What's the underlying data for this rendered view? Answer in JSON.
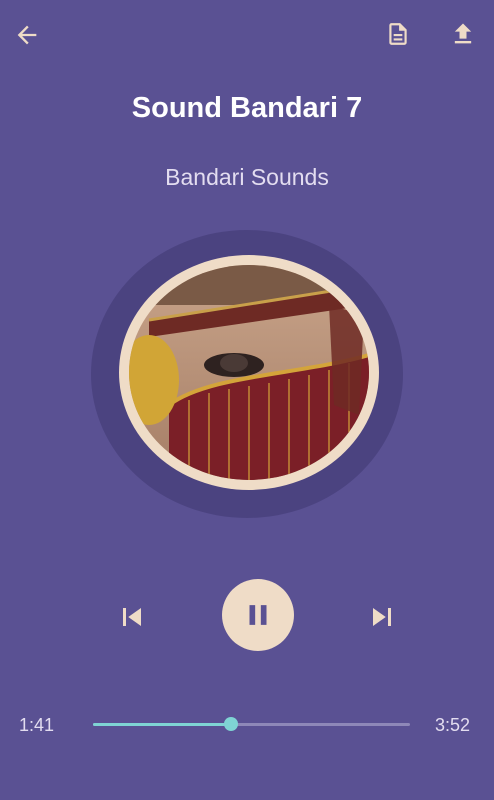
{
  "player": {
    "title": "Sound Bandari 7",
    "artist": "Bandari Sounds",
    "current_time": "1:41",
    "total_time": "3:52",
    "progress": 0.435,
    "state": "playing"
  },
  "icons": {
    "back": "arrow-left-icon",
    "document": "document-icon",
    "upload": "upload-icon",
    "previous": "skip-previous-icon",
    "pause": "pause-icon",
    "next": "skip-next-icon"
  },
  "colors": {
    "background": "#5a5193",
    "accent": "#7fd4d4",
    "control": "#efdcc7"
  }
}
